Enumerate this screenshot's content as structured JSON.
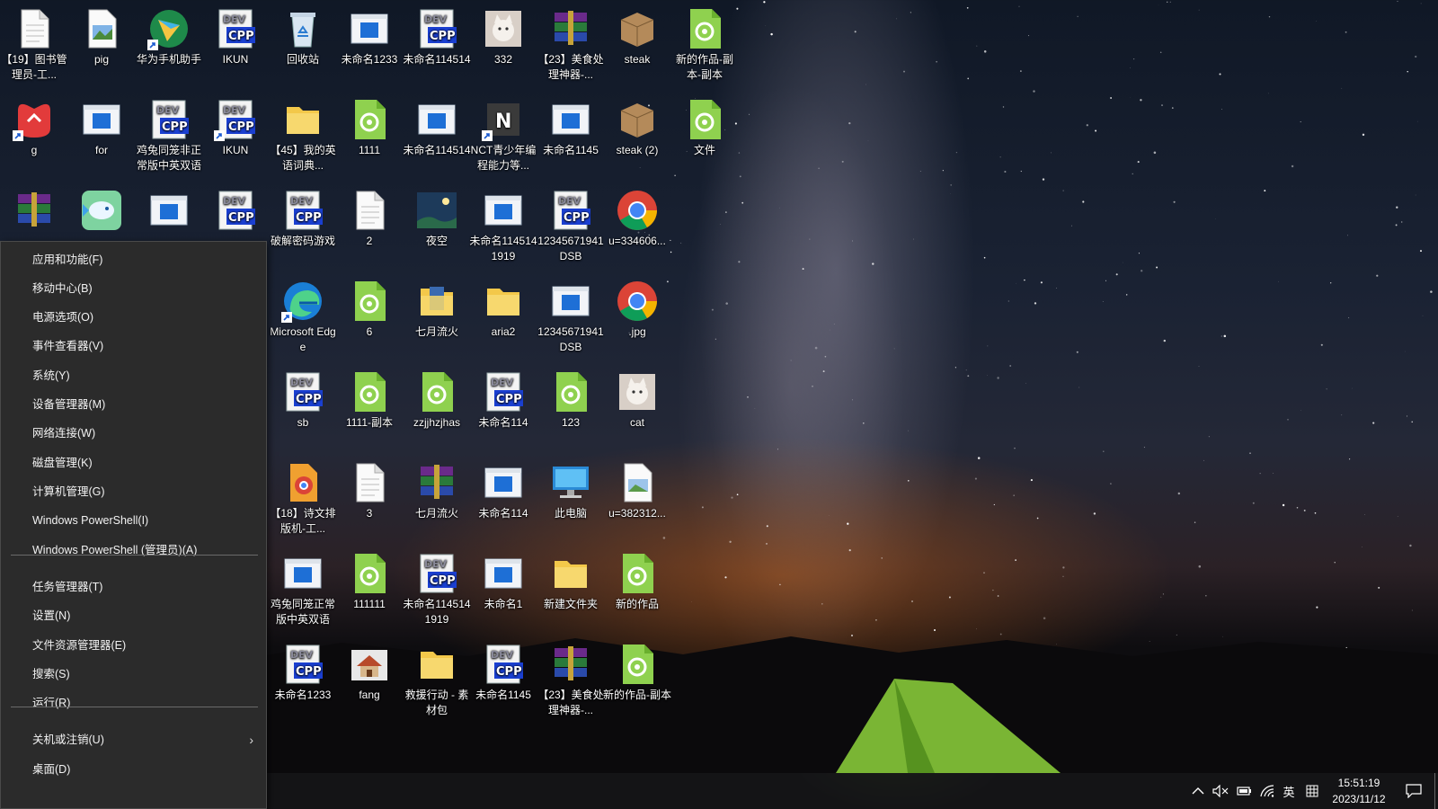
{
  "desktop": {
    "icons": [
      {
        "label": "【19】图书管理员-工...",
        "type": "file"
      },
      {
        "label": "pig",
        "type": "image"
      },
      {
        "label": "华为手机助手",
        "type": "hisuite",
        "shortcut": true
      },
      {
        "label": "IKUN",
        "type": "cpp"
      },
      {
        "label": "回收站",
        "type": "recycle"
      },
      {
        "label": "未命名1233",
        "type": "exe"
      },
      {
        "label": "未命名114514",
        "type": "cpp"
      },
      {
        "label": "332",
        "type": "cat"
      },
      {
        "label": "【23】美食处理神器-...",
        "type": "rar"
      },
      {
        "label": "steak",
        "type": "box"
      },
      {
        "label": "新的作品-副本-副本",
        "type": "py"
      },
      {
        "label": "g",
        "type": "redapp",
        "shortcut": true
      },
      {
        "label": "for",
        "type": "exe"
      },
      {
        "label": "鸡兔同笼非正常版中英双语",
        "type": "cpp"
      },
      {
        "label": "IKUN",
        "type": "cpp",
        "shortcut": true
      },
      {
        "label": "【45】我的英语词典...",
        "type": "folder"
      },
      {
        "label": "1111",
        "type": "py"
      },
      {
        "label": "未命名114514",
        "type": "exe"
      },
      {
        "label": "NCT青少年编程能力等...",
        "type": "nct",
        "shortcut": true
      },
      {
        "label": "未命名1145",
        "type": "exe"
      },
      {
        "label": "steak (2)",
        "type": "box"
      },
      {
        "label": "文件",
        "type": "py"
      },
      {
        "label": "",
        "type": "rar"
      },
      {
        "label": "",
        "type": "fish"
      },
      {
        "label": "",
        "type": "exe"
      },
      {
        "label": "",
        "type": "cpp"
      },
      {
        "label": "破解密码游戏",
        "type": "cpp"
      },
      {
        "label": "2",
        "type": "file"
      },
      {
        "label": "夜空",
        "type": "night"
      },
      {
        "label": "未命名1145141919",
        "type": "exe"
      },
      {
        "label": "12345671941DSB",
        "type": "cpp"
      },
      {
        "label": "u=334606...",
        "type": "chrome"
      },
      {
        "label": "Microsoft Edge",
        "type": "edge",
        "shortcut": true
      },
      {
        "label": "6",
        "type": "py"
      },
      {
        "label": "七月流火",
        "type": "folderbook"
      },
      {
        "label": "aria2",
        "type": "folder"
      },
      {
        "label": "12345671941DSB",
        "type": "exe"
      },
      {
        "label": ".jpg",
        "type": "chrome"
      },
      {
        "label": "sb",
        "type": "cpp"
      },
      {
        "label": "1111-副本",
        "type": "py"
      },
      {
        "label": "zzjjhzjhas",
        "type": "py"
      },
      {
        "label": "未命名114",
        "type": "cpp"
      },
      {
        "label": "123",
        "type": "py"
      },
      {
        "label": "cat",
        "type": "cat"
      },
      {
        "label": "【18】诗文排版机-工...",
        "type": "chromefile"
      },
      {
        "label": "3",
        "type": "file"
      },
      {
        "label": "七月流火",
        "type": "rar"
      },
      {
        "label": "未命名114",
        "type": "exe"
      },
      {
        "label": "此电脑",
        "type": "pc"
      },
      {
        "label": "u=382312...",
        "type": "imgfile"
      },
      {
        "label": "鸡兔同笼正常版中英双语",
        "type": "exe"
      },
      {
        "label": "111111",
        "type": "py"
      },
      {
        "label": "未命名1145141919",
        "type": "cpp"
      },
      {
        "label": "未命名1",
        "type": "exe"
      },
      {
        "label": "新建文件夹",
        "type": "folder"
      },
      {
        "label": "新的作品",
        "type": "py"
      },
      {
        "label": "未命名1233",
        "type": "cpp"
      },
      {
        "label": "fang",
        "type": "house"
      },
      {
        "label": "救援行动 - 素材包",
        "type": "folder"
      },
      {
        "label": "未命名1145",
        "type": "cpp"
      },
      {
        "label": "【23】美食处理神器-...",
        "type": "rar"
      },
      {
        "label": "新的作品-副本",
        "type": "py"
      }
    ]
  },
  "context_menu": {
    "items": [
      "应用和功能(F)",
      "移动中心(B)",
      "电源选项(O)",
      "事件查看器(V)",
      "系统(Y)",
      "设备管理器(M)",
      "网络连接(W)",
      "磁盘管理(K)",
      "计算机管理(G)",
      "Windows PowerShell(I)",
      "Windows PowerShell (管理员)(A)",
      "任务管理器(T)",
      "设置(N)",
      "文件资源管理器(E)",
      "搜索(S)",
      "运行(R)",
      "关机或注销(U)",
      "桌面(D)"
    ],
    "submenu_item": "关机或注销(U)"
  },
  "taskbar": {
    "tray": {
      "chevron_icon": "chevron-up-icon",
      "volume_icon": "volume-muted-icon",
      "battery_icon": "battery-icon",
      "wifi_icon": "wifi-icon",
      "ime_label": "英",
      "ime_mode_icon": "input-mode-icon",
      "notification_icon": "notification-icon"
    },
    "time": "15:51:19",
    "date": "2023/11/12"
  },
  "colors": {
    "menu_bg": "#2b2b2b",
    "taskbar_bg": "#161618",
    "py_green": "#8fd14f",
    "cpp_blue": "#1a3fd0"
  }
}
